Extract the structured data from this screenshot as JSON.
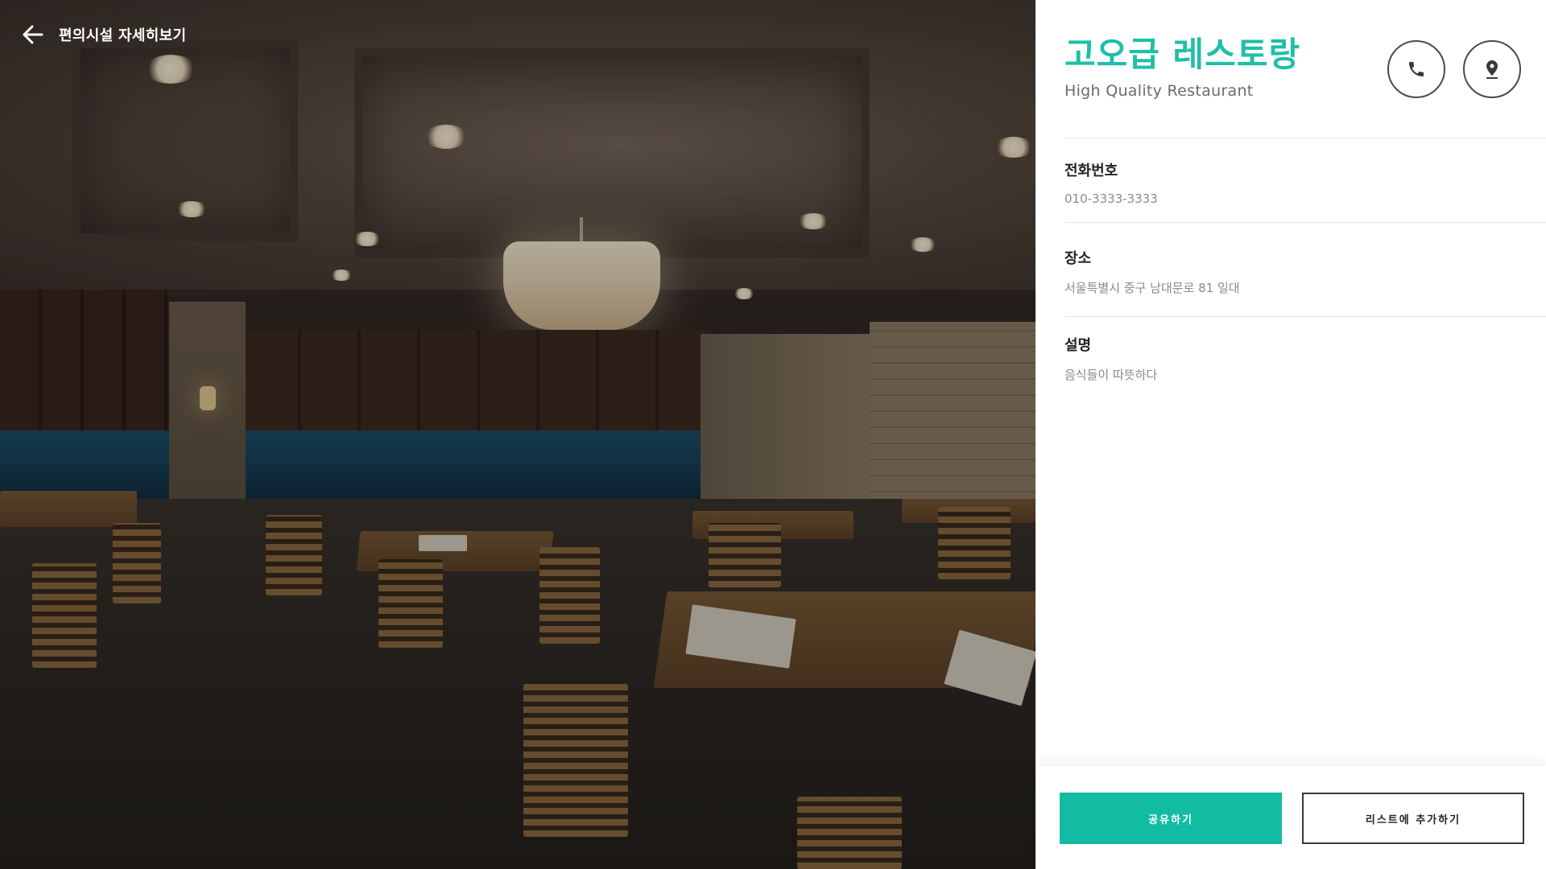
{
  "header": {
    "title": "편의시설 자세히보기",
    "back_icon": "arrow-left-icon"
  },
  "photo": {
    "subject": "restaurant-interior-photo"
  },
  "facility": {
    "name": "고오급 레스토랑",
    "subtitle": "High Quality Restaurant",
    "accent_color": "#1fbfa8"
  },
  "actions_top": {
    "call_icon": "phone-icon",
    "map_icon": "map-pin-icon"
  },
  "details": [
    {
      "label": "전화번호",
      "value": "010-3333-3333"
    },
    {
      "label": "장소",
      "value": "서울특별시 중구 남대문로 81 일대"
    },
    {
      "label": "설명",
      "value": "음식들이 따뜻하다"
    }
  ],
  "bottom_bar": {
    "share_label": "공유하기",
    "add_label": "리스트에 추가하기",
    "share_color": "#12bca2"
  }
}
